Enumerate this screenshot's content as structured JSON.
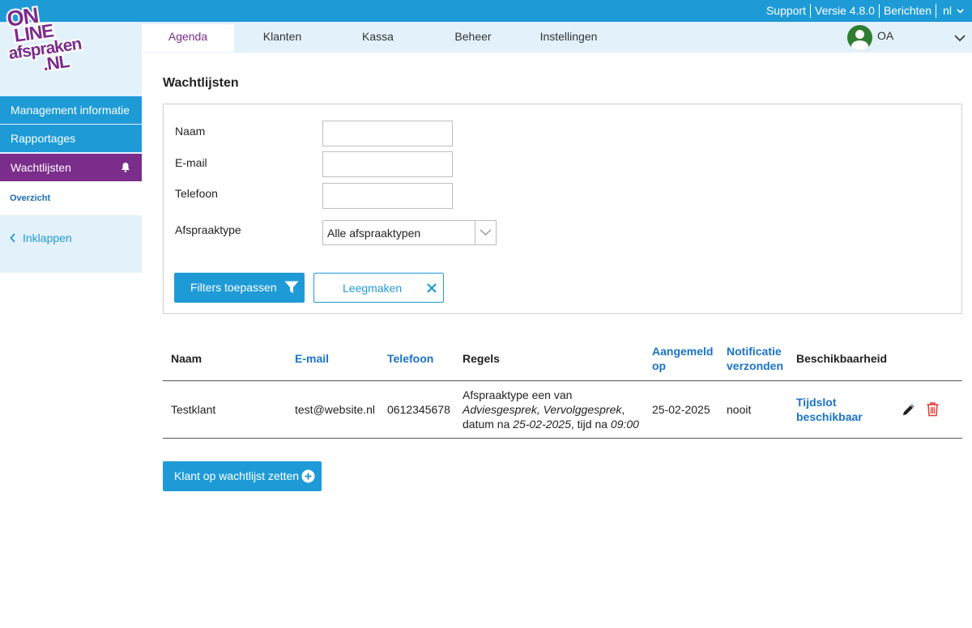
{
  "top_links": [
    "Support",
    "Versie 4.8.0",
    "Berichten"
  ],
  "language": "nl",
  "logo_text": "ONLINE afspraken .NL",
  "nav": {
    "tabs": [
      "Agenda",
      "Klanten",
      "Kassa",
      "Beheer",
      "Instellingen"
    ],
    "active": "Agenda",
    "user_initials": "OA"
  },
  "sidebar": {
    "items": [
      "Management informatie",
      "Rapportages",
      "Wachtlijsten"
    ],
    "active": "Wachtlijsten",
    "sub_item": "Overzicht",
    "collapse_label": "Inklappen"
  },
  "page_title": "Wachtlijsten",
  "filters": {
    "name_label": "Naam",
    "email_label": "E-mail",
    "phone_label": "Telefoon",
    "type_label": "Afspraaktype",
    "name_value": "",
    "email_value": "",
    "phone_value": "",
    "type_selected": "Alle afspraaktypen",
    "apply_label": "Filters toepassen",
    "clear_label": "Leegmaken"
  },
  "table": {
    "headers": {
      "naam": "Naam",
      "email": "E-mail",
      "telefoon": "Telefoon",
      "regels": "Regels",
      "aangemeld_1": "Aangemeld",
      "aangemeld_2": "op",
      "notificatie_1": "Notificatie",
      "notificatie_2": "verzonden",
      "beschikbaarheid": "Beschikbaarheid"
    },
    "rows": [
      {
        "naam": "Testklant",
        "email": "test@website.nl",
        "telefoon": "0612345678",
        "regels_line1": "Afspraaktype een van",
        "regels_types": "Adviesgesprek, Vervolggesprek",
        "regels_date_prefix": "datum na",
        "regels_date": "25-02-2025",
        "regels_time_prefix": "tijd na",
        "regels_time": "09:00",
        "aangemeld_op": "25-02-2025",
        "notificatie": "nooit",
        "beschikbaarheid_1": "Tijdslot",
        "beschikbaarheid_2": "beschikbaar"
      }
    ]
  },
  "add_button_label": "Klant op wachtlijst zetten",
  "colors": {
    "primary": "#1e9bd7",
    "purple": "#7b2d8b",
    "light_blue_bg": "#e3f1fb",
    "link": "#1a73c9",
    "delete": "#e53935"
  }
}
